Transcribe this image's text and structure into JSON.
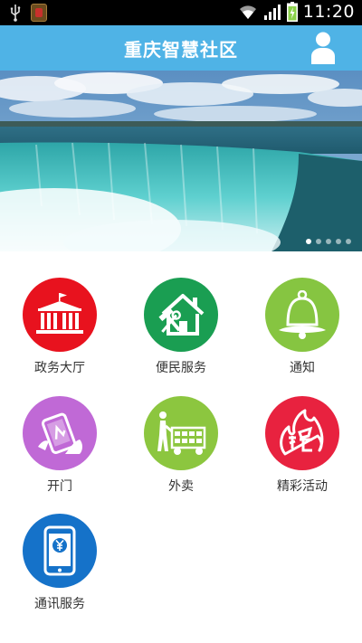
{
  "status_bar": {
    "time": "11:20",
    "icons": [
      "usb-icon",
      "app-notification-icon",
      "wifi-icon",
      "signal-icon",
      "battery-charging-icon"
    ]
  },
  "header": {
    "title": "重庆智慧社区",
    "profile_icon": "user-icon"
  },
  "banner": {
    "slide_count": 5,
    "active_slide": 1
  },
  "grid": {
    "items": [
      {
        "label": "政务大厅",
        "icon": "government-building-icon",
        "color": "#e8121e"
      },
      {
        "label": "便民服务",
        "icon": "house-tools-icon",
        "color": "#1a9e52"
      },
      {
        "label": "通知",
        "icon": "bell-icon",
        "color": "#86c541"
      },
      {
        "label": "开门",
        "icon": "phone-unlock-icon",
        "color": "#c069d6"
      },
      {
        "label": "外卖",
        "icon": "delivery-cart-icon",
        "color": "#8cc63f"
      },
      {
        "label": "精彩活动",
        "icon": "flame-grab-icon",
        "color": "#e8223f"
      },
      {
        "label": "通讯服务",
        "icon": "mobile-payment-icon",
        "color": "#1572c9"
      }
    ]
  },
  "colors": {
    "header_bg": "#4fb3e6",
    "status_bar_bg": "#000000"
  }
}
